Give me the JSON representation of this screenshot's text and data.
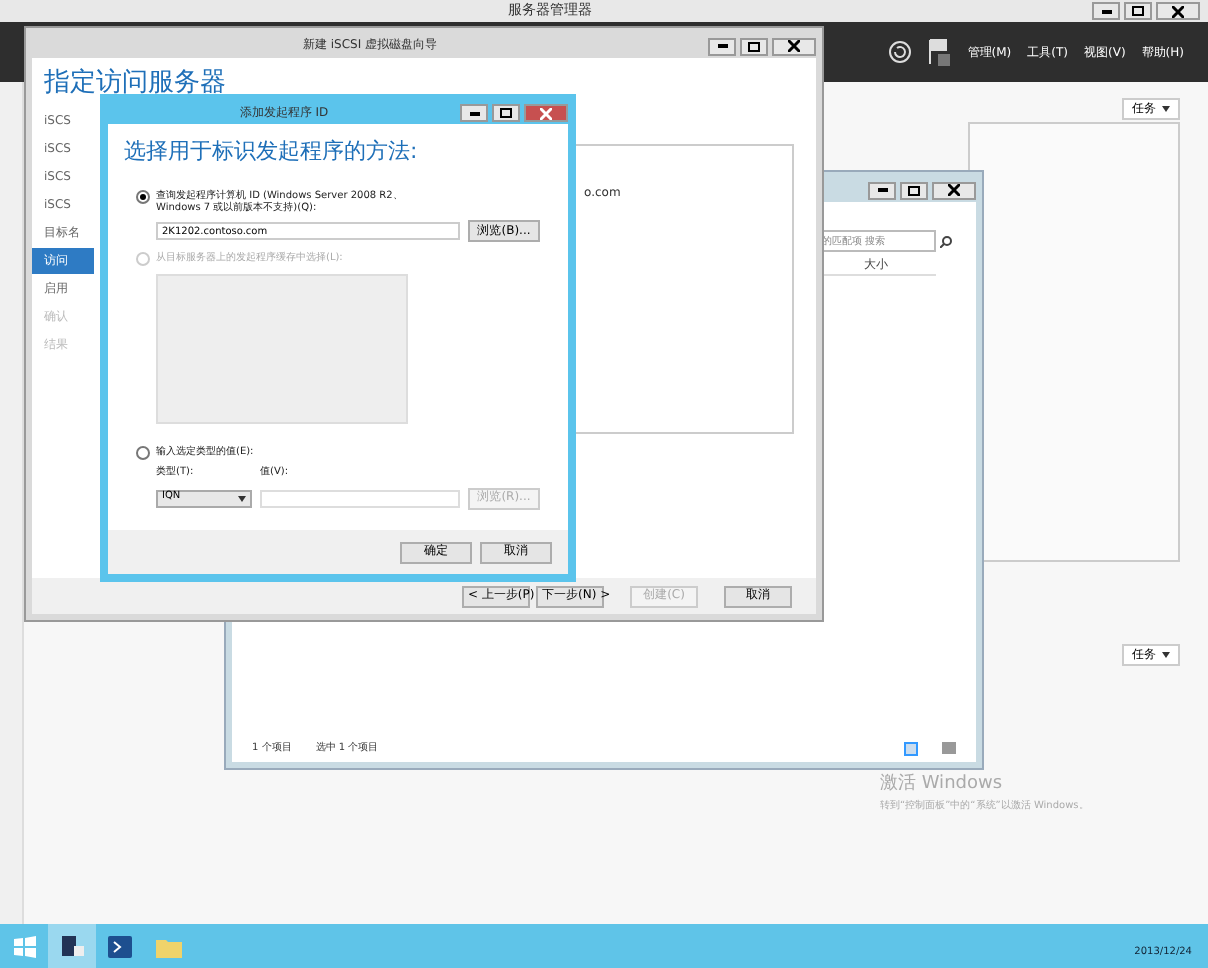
{
  "server_manager": {
    "title": "服务器管理器",
    "menu": [
      "管理(M)",
      "工具(T)",
      "视图(V)",
      "帮助(H)"
    ],
    "tasks_top": "任务",
    "tasks_bottom": "任务",
    "activation_title": "激活 Windows",
    "activation_hint": "转到“控制面板”中的“系统”以激活 Windows。"
  },
  "explorer": {
    "search_placeholder": "的匹配项 搜索",
    "column": "大小",
    "status_count": "1 个项目",
    "status_selected": "选中 1 个项目"
  },
  "wizard": {
    "title": "新建 iSCSI 虚拟磁盘向导",
    "heading": "指定访问服务器",
    "nav": [
      {
        "label": "iSCS",
        "selected": false,
        "disabled": false
      },
      {
        "label": "iSCS",
        "selected": false,
        "disabled": false
      },
      {
        "label": "iSCS",
        "selected": false,
        "disabled": false
      },
      {
        "label": "iSCS",
        "selected": false,
        "disabled": false
      },
      {
        "label": "目标名",
        "selected": false,
        "disabled": false
      },
      {
        "label": "访问",
        "selected": true,
        "disabled": false
      },
      {
        "label": "启用",
        "selected": false,
        "disabled": false
      },
      {
        "label": "确认",
        "selected": false,
        "disabled": true
      },
      {
        "label": "结果",
        "selected": false,
        "disabled": true
      }
    ],
    "list_cell": "o.com",
    "buttons": [
      {
        "label": "< 上一步(P)",
        "disabled": false
      },
      {
        "label": "下一步(N) >",
        "disabled": false
      },
      {
        "label": "创建(C)",
        "disabled": true
      },
      {
        "label": "取消",
        "disabled": false
      }
    ]
  },
  "dialog": {
    "title": "添加发起程序 ID",
    "heading": "选择用于标识发起程序的方法:",
    "option_query": {
      "label": "查询发起程序计算机 ID (Windows Server 2008 R2、Windows 7 或以前版本不支持)(Q):",
      "selected": true,
      "disabled": false,
      "value": "2K1202.contoso.com",
      "browse": "浏览(B)..."
    },
    "option_cache": {
      "label": "从目标服务器上的发起程序缓存中选择(L):",
      "selected": false,
      "disabled": true
    },
    "option_value": {
      "label": "输入选定类型的值(E):",
      "selected": false,
      "disabled": false,
      "type_label": "类型(T):",
      "type_value": "IQN",
      "value_label": "值(V):",
      "browse": "浏览(R)...",
      "browse_disabled": true
    },
    "ok": "确定",
    "cancel": "取消"
  },
  "taskbar": {
    "apps": [
      {
        "kind": "server",
        "selected": true
      },
      {
        "kind": "powershell",
        "selected": false
      },
      {
        "kind": "folder",
        "selected": false
      }
    ],
    "date": "2013/12/24"
  }
}
